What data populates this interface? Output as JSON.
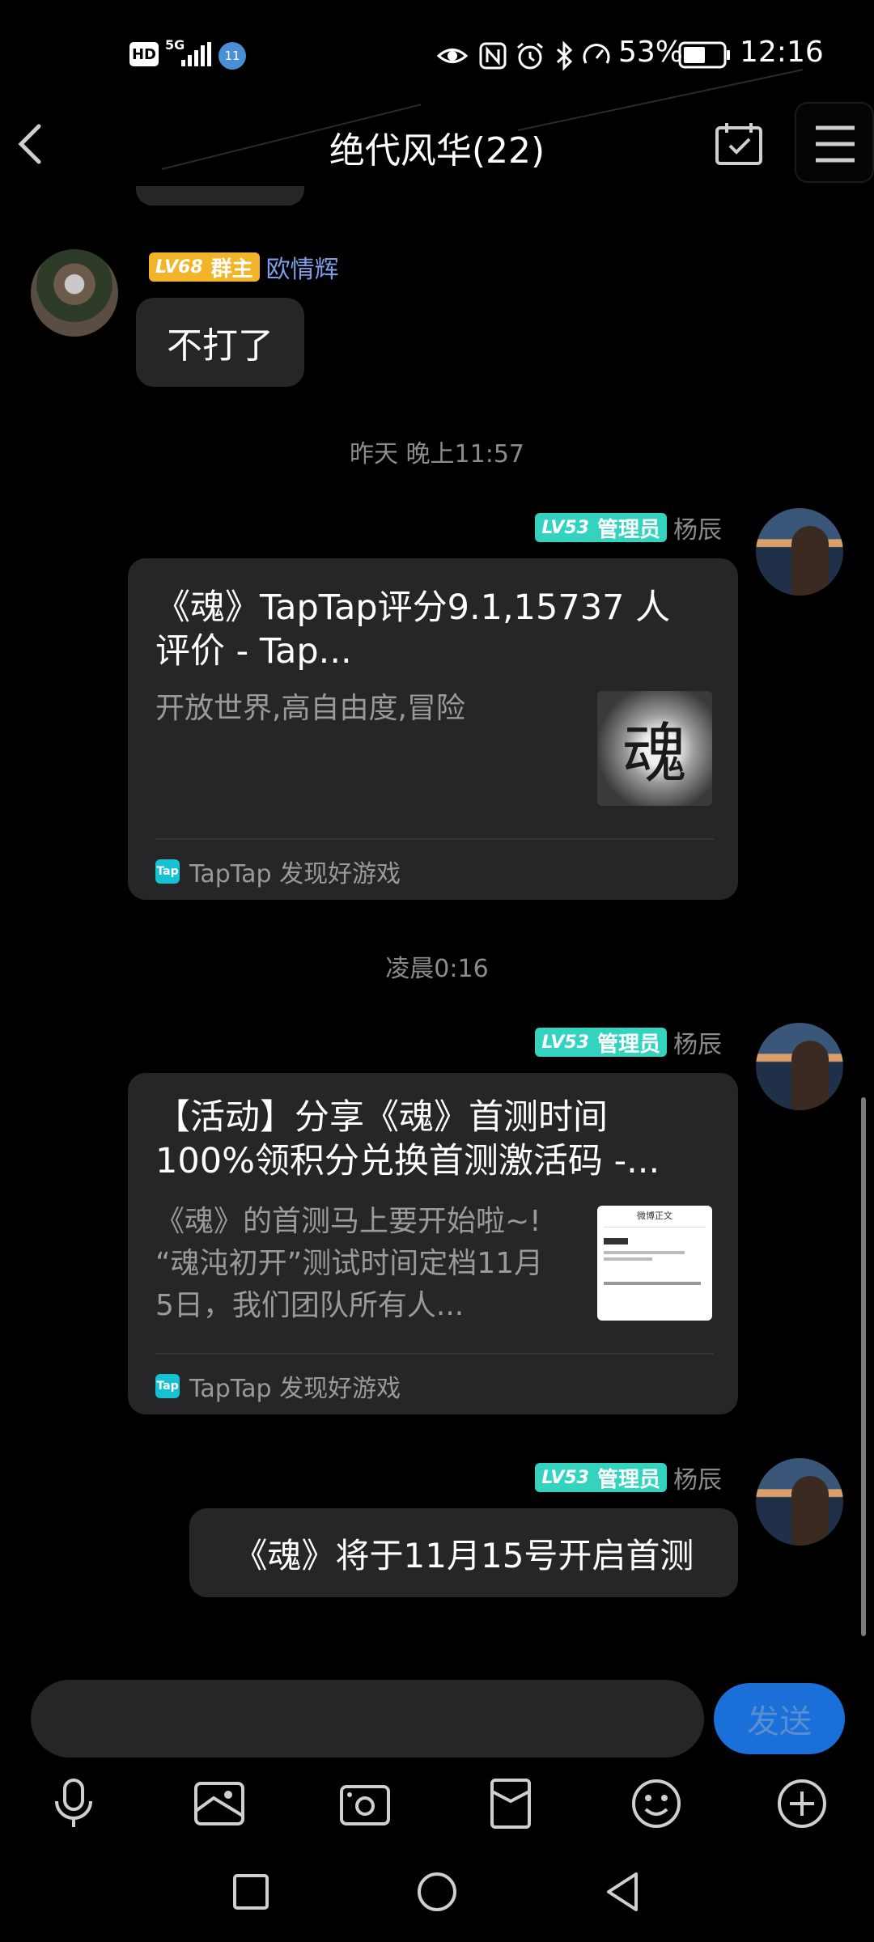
{
  "status_bar": {
    "hd": "HD",
    "network": "5G",
    "notification_badge": "11",
    "battery_percent": "53%",
    "time": "12:16",
    "icons": [
      "eye-icon",
      "nfc-icon",
      "alarm-icon",
      "bluetooth-icon",
      "speed-icon",
      "battery-icon"
    ]
  },
  "header": {
    "title": "绝代风华(22)",
    "back_icon": "chevron-left-icon",
    "calendar_icon": "calendar-check-icon",
    "menu_icon": "hamburger-menu-icon"
  },
  "messages": {
    "m1": {
      "level": "LV68",
      "role": "群主",
      "sender": "欧情辉",
      "text": "不打了"
    },
    "ts1": "昨天 晚上11:57",
    "m2": {
      "level": "LV53",
      "role": "管理员",
      "sender": "杨辰",
      "card_title_line1": "《魂》TapTap评分9.1,15737 人",
      "card_title_line2": "评价 - Tap...",
      "card_desc_line1": "开放世界,高自由度,冒险",
      "thumb_glyph": "魂",
      "source_logo": "Tap",
      "source": "TapTap 发现好游戏"
    },
    "ts2": "凌晨0:16",
    "m3": {
      "level": "LV53",
      "role": "管理员",
      "sender": "杨辰",
      "card_title_line1": "【活动】分享《魂》首测时间",
      "card_title_line2": "100%领积分兑换首测激活码 -...",
      "card_desc_line1": "《魂》的首测马上要开始啦~!",
      "card_desc_line2": "“魂沌初开”测试时间定档11月",
      "card_desc_line3": "5日，我们团队所有人...",
      "thumb_title": "微博正文",
      "source_logo": "Tap",
      "source": "TapTap 发现好游戏"
    },
    "m4": {
      "level": "LV53",
      "role": "管理员",
      "sender": "杨辰",
      "text": "《魂》将于11月15号开启首测"
    }
  },
  "composer": {
    "input_value": "",
    "send_label": "发送"
  },
  "toolbar": [
    "microphone-icon",
    "image-icon",
    "camera-icon",
    "red-packet-icon",
    "emoji-icon",
    "plus-circle-icon"
  ],
  "nav_bar": [
    "recent-apps-icon",
    "home-icon",
    "back-icon"
  ]
}
